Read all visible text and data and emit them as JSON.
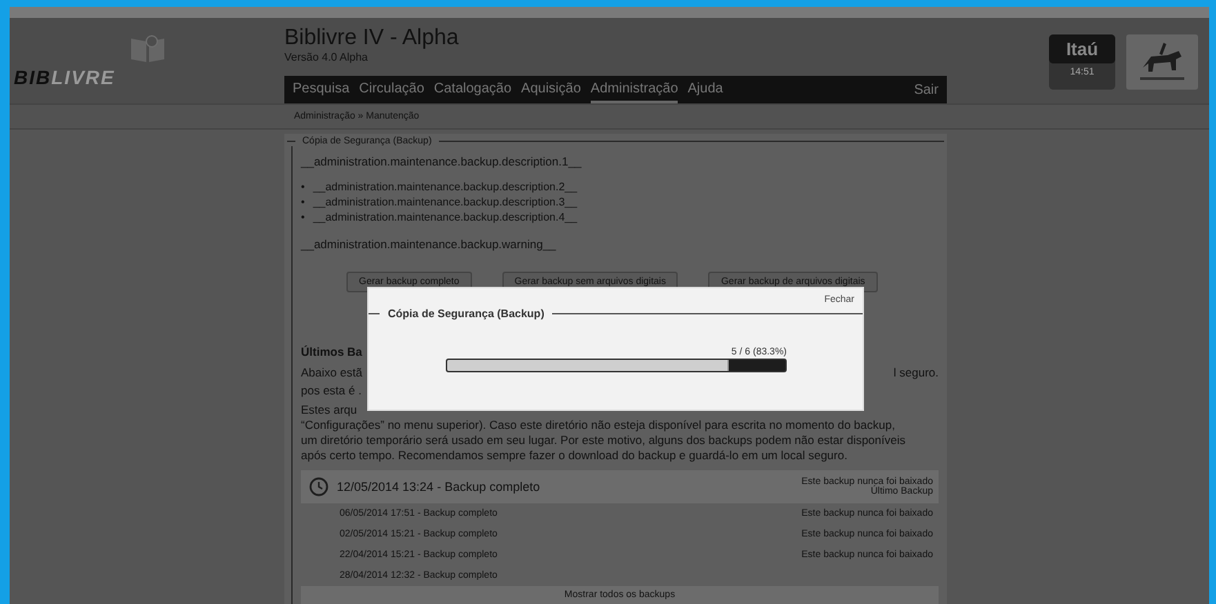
{
  "header": {
    "logo": {
      "dark": "BIB",
      "light": "LIVRE"
    },
    "title": "Biblivre IV - Alpha",
    "version": "Versão 4.0 Alpha",
    "sponsor": {
      "name": "Itaú",
      "caption": "14:51"
    }
  },
  "nav": {
    "items": [
      {
        "label": "Pesquisa",
        "selected": false
      },
      {
        "label": "Circulação",
        "selected": false
      },
      {
        "label": "Catalogação",
        "selected": false
      },
      {
        "label": "Aquisição",
        "selected": false
      },
      {
        "label": "Administração",
        "selected": true
      },
      {
        "label": "Ajuda",
        "selected": false
      }
    ],
    "logout": "Sair"
  },
  "breadcrumb": "Administração » Manutenção",
  "section": {
    "legend": "Cópia de Segurança (Backup)",
    "description": "__administration.maintenance.backup.description.1__",
    "bullets": [
      {
        "marker": "•",
        "text": "__administration.maintenance.backup.description.2__"
      },
      {
        "marker": "•",
        "text": "__administration.maintenance.backup.description.3__"
      },
      {
        "marker": "•",
        "text": "__administration.maintenance.backup.description.4__"
      }
    ],
    "warning": "__administration.maintenance.backup.warning__",
    "buttons": [
      "Gerar backup completo",
      "Gerar backup sem arquivos digitais",
      "Gerar backup de arquivos digitais"
    ],
    "recent_title": "Últimos Ba",
    "partial_lines": [
      {
        "left": "Abaixo estã",
        "right": "l seguro."
      },
      {
        "left": "pos esta é ."
      },
      {
        "left": "Estes arqu"
      }
    ],
    "paragraph_lines": [
      "“Configurações” no menu superior). Caso este diretório não esteja disponível para escrita no momento do backup,",
      "um diretório temporário será usado em seu lugar. Por este motivo, alguns dos backups podem não estar disponíveis",
      "após certo tempo. Recomendamos sempre fazer o download do backup e guardá-lo em um local seguro."
    ],
    "backups": [
      {
        "text": "12/05/2014 13:24 - Backup completo",
        "status": "Este backup nunca foi baixado",
        "note": "Último Backup",
        "latest": true
      },
      {
        "text": "06/05/2014 17:51 - Backup completo",
        "status": "Este backup nunca foi baixado",
        "latest": false
      },
      {
        "text": "02/05/2014 15:21 - Backup completo",
        "status": "Este backup nunca foi baixado",
        "latest": false
      },
      {
        "text": "22/04/2014 15:21 - Backup completo",
        "status": "Este backup nunca foi baixado",
        "latest": false
      },
      {
        "text": "28/04/2014 12:32 - Backup completo",
        "latest": false
      }
    ],
    "show_all": "Mostrar todos os backups"
  },
  "modal": {
    "close": "Fechar",
    "legend": "Cópia de Segurança (Backup)",
    "progress": {
      "label": "5 / 6 (83.3%)",
      "level": 0.833
    }
  }
}
